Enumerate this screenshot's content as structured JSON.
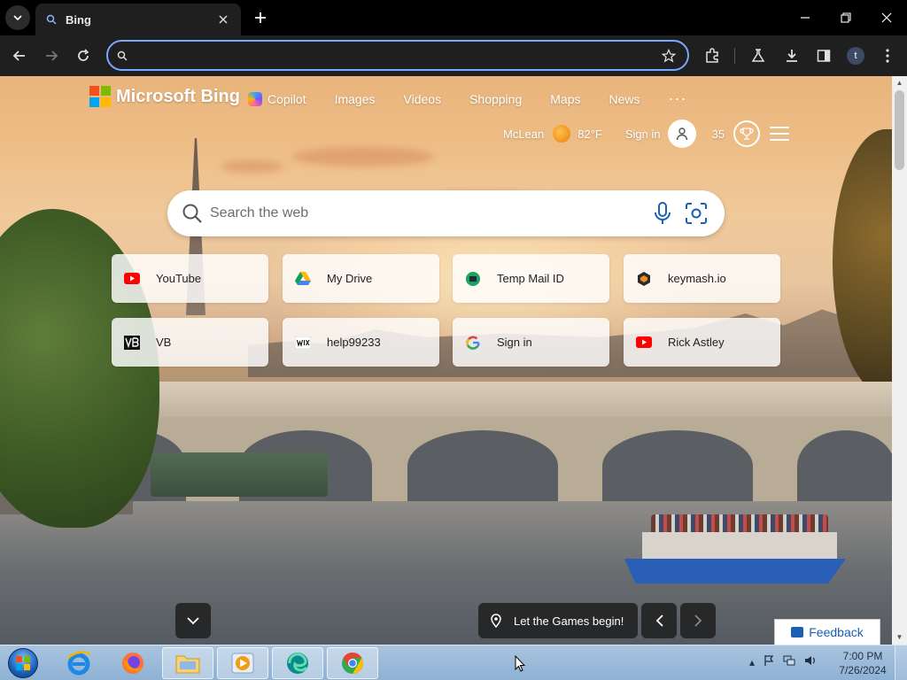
{
  "browser": {
    "tab_title": "Bing",
    "omnibox_value": "",
    "profile_initial": "t"
  },
  "bing": {
    "brand": "Microsoft Bing",
    "nav": {
      "copilot": "Copilot",
      "images": "Images",
      "videos": "Videos",
      "shopping": "Shopping",
      "maps": "Maps",
      "news": "News",
      "more": "···"
    },
    "location": "McLean",
    "temperature": "82°F",
    "signin": "Sign in",
    "points": "35",
    "search_placeholder": "Search the web",
    "tiles": [
      {
        "label": "YouTube",
        "icon": "youtube-icon"
      },
      {
        "label": "My Drive",
        "icon": "google-drive-icon"
      },
      {
        "label": "Temp Mail ID",
        "icon": "temp-mail-icon"
      },
      {
        "label": "keymash.io",
        "icon": "keymash-icon"
      },
      {
        "label": "VB",
        "icon": "vb-icon"
      },
      {
        "label": "help99233",
        "icon": "wix-icon"
      },
      {
        "label": "Sign in",
        "icon": "google-icon"
      },
      {
        "label": "Rick Astley",
        "icon": "youtube-icon"
      }
    ],
    "games_text": "Let the Games begin!",
    "feedback": "Feedback"
  },
  "taskbar": {
    "time": "7:00 PM",
    "date": "7/26/2024"
  },
  "colors": {
    "accent_focus": "#7aa7ff",
    "youtube_red": "#ff0000",
    "feedback_blue": "#1a5fb4"
  }
}
